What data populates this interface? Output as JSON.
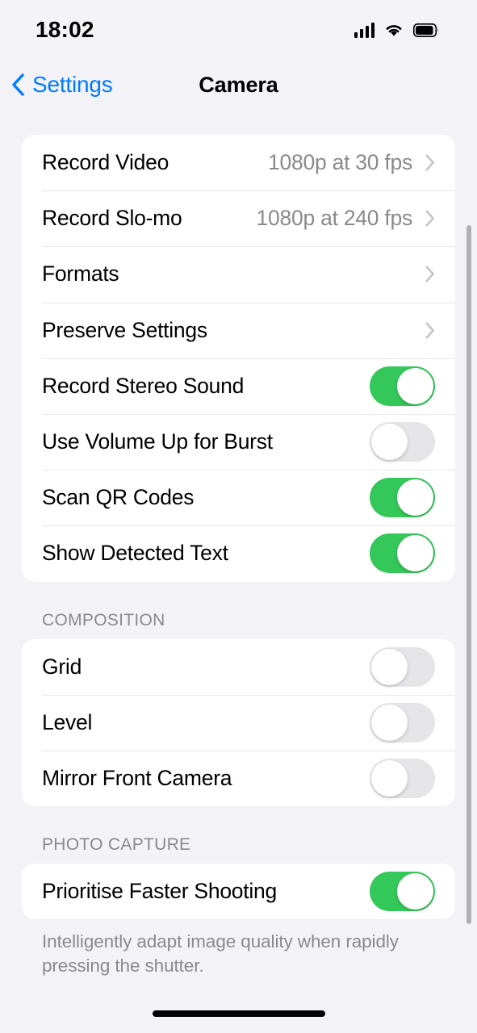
{
  "status_bar": {
    "time": "18:02",
    "signal_icon": "cellular-signal-icon",
    "wifi_icon": "wifi-icon",
    "battery_icon": "battery-icon"
  },
  "nav": {
    "back_label": "Settings",
    "back_icon": "chevron-left-icon",
    "title": "Camera"
  },
  "colors": {
    "accent_blue": "#007AFF",
    "toggle_on_green": "#34C759",
    "toggle_off_grey": "#E5E5E7",
    "page_background": "#F2F2F7",
    "card_background": "#FFFFFF",
    "secondary_text": "#8A8A8E"
  },
  "sections": [
    {
      "header": "",
      "footer": "",
      "rows": [
        {
          "label": "Record Video",
          "type": "disclosure",
          "value": "1080p at 30 fps"
        },
        {
          "label": "Record Slo-mo",
          "type": "disclosure",
          "value": "1080p at 240 fps"
        },
        {
          "label": "Formats",
          "type": "disclosure",
          "value": ""
        },
        {
          "label": "Preserve Settings",
          "type": "disclosure",
          "value": ""
        },
        {
          "label": "Record Stereo Sound",
          "type": "toggle",
          "on": true
        },
        {
          "label": "Use Volume Up for Burst",
          "type": "toggle",
          "on": false
        },
        {
          "label": "Scan QR Codes",
          "type": "toggle",
          "on": true
        },
        {
          "label": "Show Detected Text",
          "type": "toggle",
          "on": true
        }
      ]
    },
    {
      "header": "COMPOSITION",
      "footer": "",
      "rows": [
        {
          "label": "Grid",
          "type": "toggle",
          "on": false
        },
        {
          "label": "Level",
          "type": "toggle",
          "on": false
        },
        {
          "label": "Mirror Front Camera",
          "type": "toggle",
          "on": false
        }
      ]
    },
    {
      "header": "PHOTO CAPTURE",
      "footer": "Intelligently adapt image quality when rapidly pressing the shutter.",
      "rows": [
        {
          "label": "Prioritise Faster Shooting",
          "type": "toggle",
          "on": true
        }
      ]
    }
  ],
  "scrollbar": {
    "name": "vertical-scrollbar"
  },
  "home_indicator": {
    "name": "home-indicator"
  }
}
